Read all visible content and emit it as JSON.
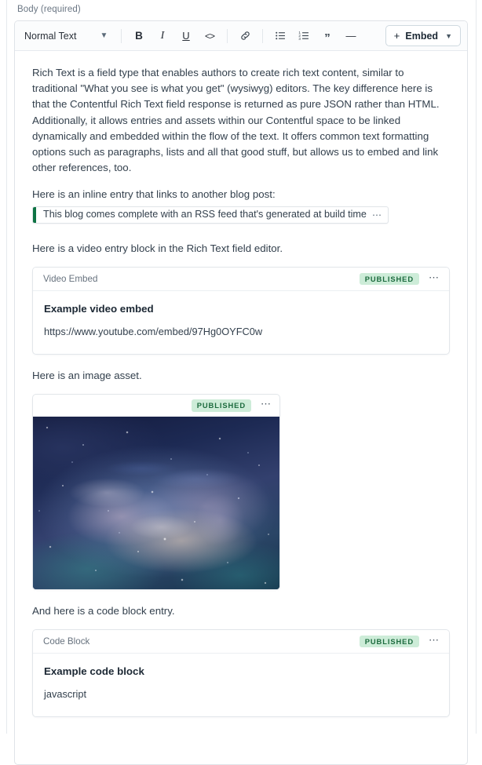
{
  "field": {
    "label": "Body (required)"
  },
  "toolbar": {
    "style_value": "Normal Text",
    "style_caret": "chevron-down",
    "bold_label": "B",
    "italic_label": "I",
    "underline_label": "U",
    "code_label": "<>",
    "link_label": "link",
    "bulleted_list_label": "bulleted-list",
    "numbered_list_label": "numbered-list",
    "quote_label": "”",
    "hr_label": "—",
    "embed_plus": "+",
    "embed_label": "Embed",
    "embed_caret": "chevron-down"
  },
  "content": {
    "intro_paragraph": "Rich Text is a field type that enables authors to create rich text content, similar to traditional \"What you see is what you get\" (wysiwyg) editors. The key difference here is that the Contentful Rich Text field response is returned as pure JSON rather than HTML. Additionally, it allows entries and assets within our Contentful space to be linked dynamically and embedded within the flow of the text. It offers common text formatting options such as paragraphs, lists and all that good stuff, but allows us to embed and link other references, too.",
    "inline_entry_lead": "Here is an inline entry that links to another blog post:",
    "inline_entry": {
      "title": "This blog comes complete with an RSS feed that's generated at build time",
      "menu": "⋯",
      "accent_color": "#0e7344"
    },
    "video_lead": "Here is a video entry block in the Rich Text field editor.",
    "video_card": {
      "type": "Video Embed",
      "status": "PUBLISHED",
      "menu": "⋯",
      "title": "Example video embed",
      "subtitle": "https://www.youtube.com/embed/97Hg0OYFC0w"
    },
    "image_lead": "Here is an image asset.",
    "image_card": {
      "status": "PUBLISHED",
      "menu": "⋯",
      "alt": "night sky milky way galaxy photograph"
    },
    "code_lead": "And here is a code block entry.",
    "code_card": {
      "type": "Code Block",
      "status": "PUBLISHED",
      "menu": "⋯",
      "title": "Example code block",
      "subtitle": "javascript"
    }
  },
  "colors": {
    "status_badge_bg": "#cdecd8",
    "status_badge_text": "#1c6b3e",
    "border": "#e2e6ea",
    "text": "#33404d"
  }
}
